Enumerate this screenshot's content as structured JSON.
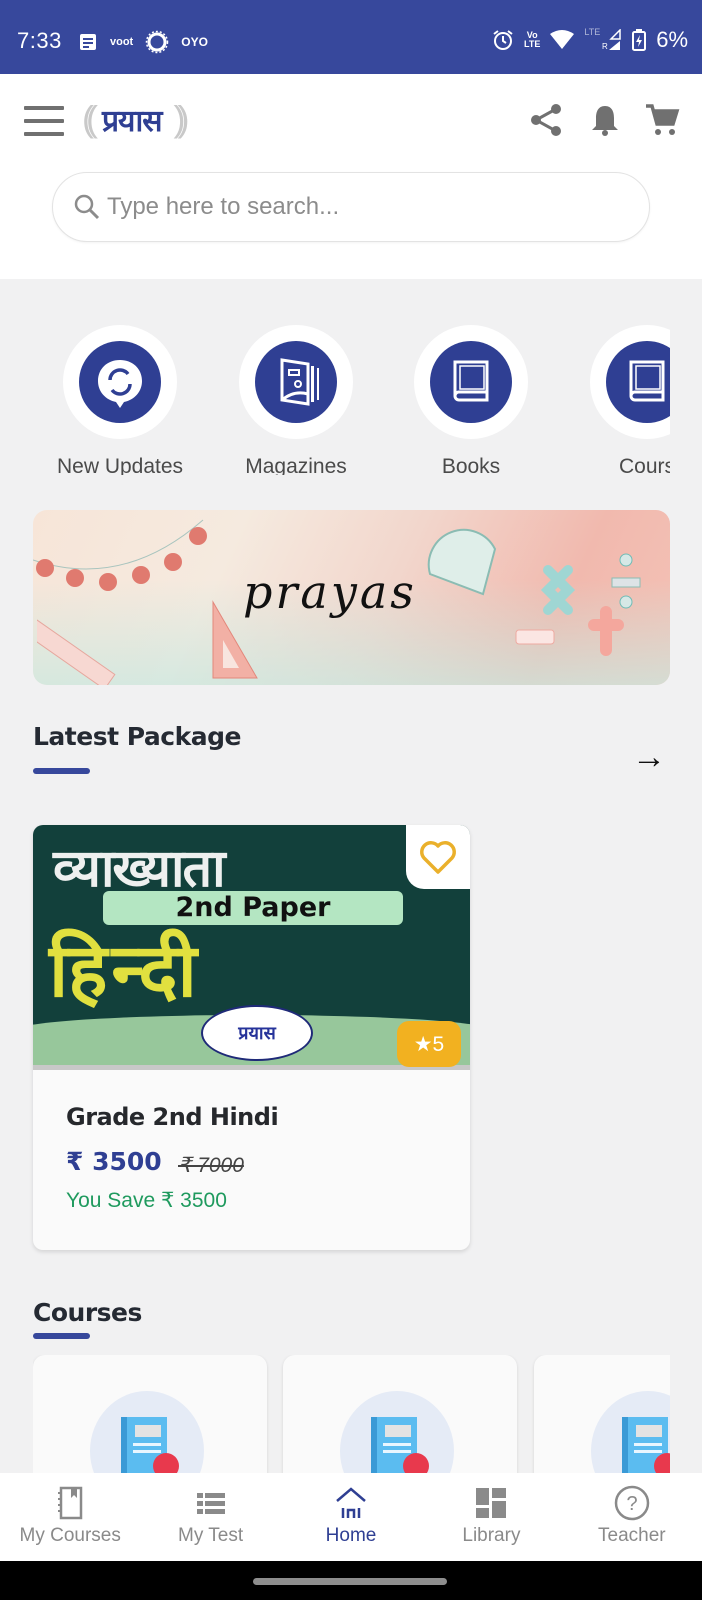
{
  "status_bar": {
    "time": "7:33",
    "left_icons": [
      "news-icon",
      "voot-icon",
      "sun-icon",
      "oyo-icon"
    ],
    "voot_label": "voot",
    "oyo_label": "OYO",
    "volte_top": "Vo",
    "volte_bottom": "LTE",
    "lte_label": "LTE",
    "roaming_label": "R",
    "battery": "6%"
  },
  "header": {
    "logo_text": "प्रयास",
    "logo_waves_left": "((",
    "logo_waves_right": "))",
    "icons": [
      "menu-icon",
      "share-icon",
      "bell-icon",
      "cart-icon"
    ]
  },
  "search": {
    "placeholder": "Type here to search...",
    "value": ""
  },
  "categories": [
    {
      "label": "New Updates",
      "icon": "refresh-bubble-icon"
    },
    {
      "label": "Magazines",
      "icon": "magazine-icon"
    },
    {
      "label": "Books",
      "icon": "book-icon"
    },
    {
      "label": "Cours",
      "icon": "book-icon"
    }
  ],
  "banner": {
    "text": "prayas"
  },
  "latest_package": {
    "title": "Latest Package",
    "accent_color": "#37489c",
    "items": [
      {
        "thumb_title_line1": "व्याख्याता",
        "thumb_paper": "2nd Paper",
        "thumb_title_line2": "हिन्दी",
        "thumb_seal": "प्रयास",
        "rating": "★5",
        "name": "Grade 2nd Hindi",
        "price": "₹ 3500",
        "original_price": "₹ 7000",
        "savings": "You Save ₹ 3500"
      }
    ]
  },
  "courses": {
    "title": "Courses",
    "cards_visible": 3
  },
  "bottom_nav": {
    "items": [
      {
        "label": "My Courses",
        "icon": "notebook-icon",
        "active": false
      },
      {
        "label": "My Test",
        "icon": "list-icon",
        "active": false
      },
      {
        "label": "Home",
        "icon": "home-icon",
        "active": true
      },
      {
        "label": "Library",
        "icon": "dashboard-icon",
        "active": false
      },
      {
        "label": "Teacher",
        "icon": "help-circle-icon",
        "active": false
      }
    ]
  },
  "colors": {
    "primary": "#37489c",
    "price": "#2f3f93",
    "savings": "#1f9a5e",
    "rating_badge": "#f2b120",
    "favorite": "#eab02b"
  }
}
